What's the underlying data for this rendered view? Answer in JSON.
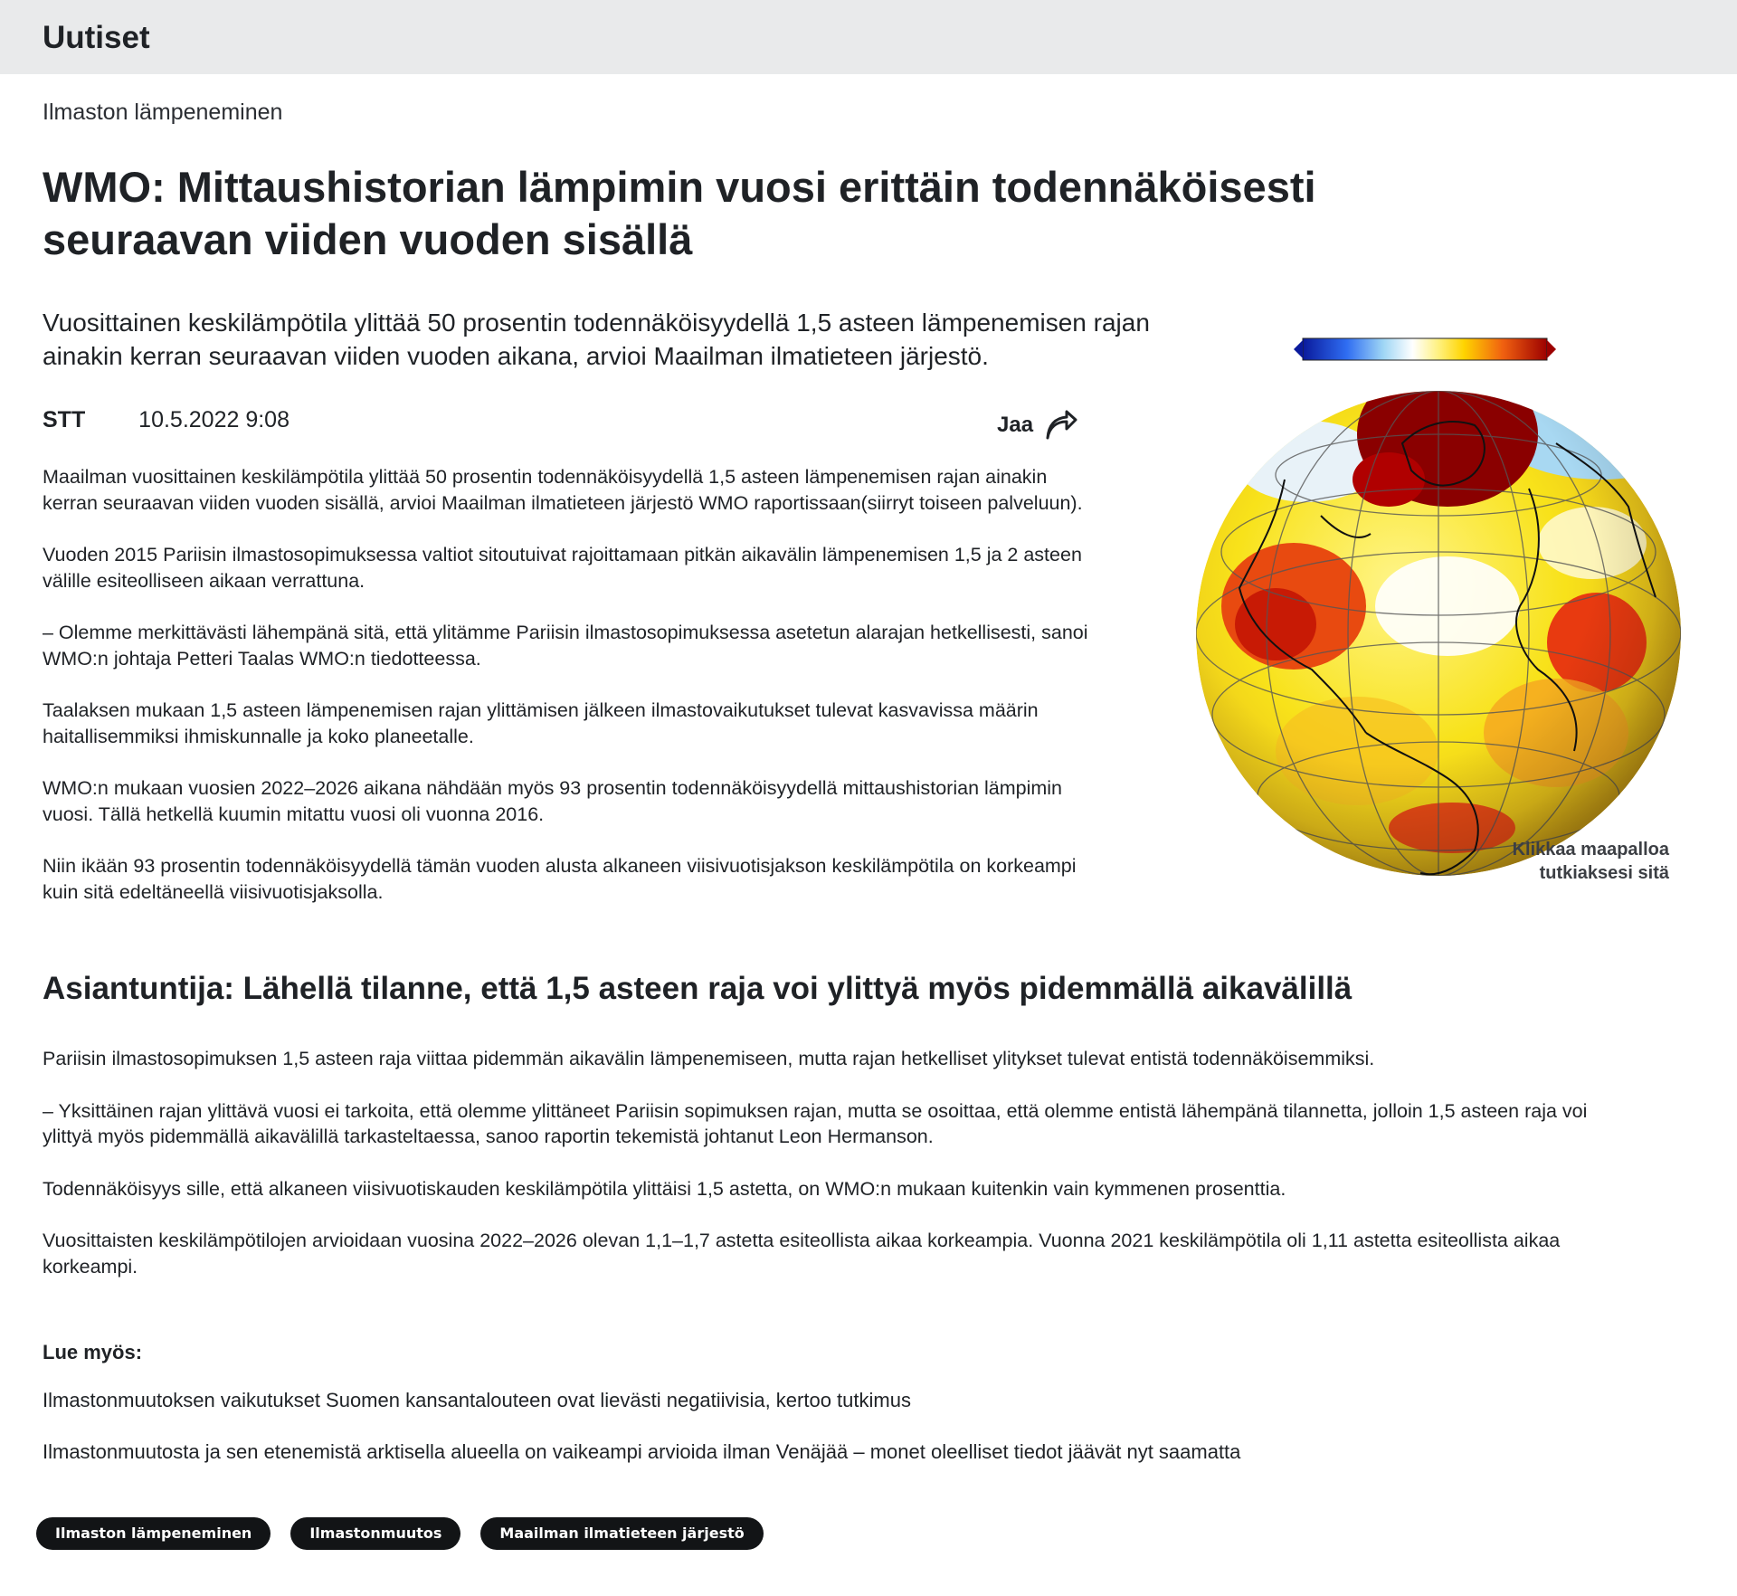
{
  "header": {
    "brand": "Uutiset"
  },
  "article": {
    "section": "Ilmaston lämpeneminen",
    "headline": "WMO: Mittaushistorian lämpimin vuosi erittäin todennäköisesti seuraavan viiden vuoden sisällä",
    "lead": "Vuosittainen keskilämpötila ylittää 50 prosentin todennäköisyydellä 1,5 asteen lämpenemisen rajan ainakin kerran seuraavan viiden vuoden aikana, arvioi Maailman ilmatieteen järjestö.",
    "author": "STT",
    "date": "10.5.2022 9:08",
    "share_label": "Jaa",
    "paragraphs": [
      "Maailman vuosittainen keskilämpötila ylittää 50 prosentin todennäköisyydellä 1,5 asteen lämpenemisen rajan ainakin kerran seuraavan viiden vuoden sisällä, arvioi Maailman ilmatieteen järjestö WMO raportissaan(siirryt toiseen palveluun).",
      "Vuoden 2015 Pariisin ilmastosopimuksessa valtiot sitoutuivat rajoittamaan pitkän aikavälin lämpenemisen 1,5 ja 2 asteen välille esiteolliseen aikaan verrattuna.",
      "– Olemme merkittävästi lähempänä sitä, että ylitämme Pariisin ilmastosopimuksessa asetetun alarajan hetkellisesti, sanoi WMO:n johtaja Petteri Taalas WMO:n tiedotteessa.",
      "Taalaksen mukaan 1,5 asteen lämpenemisen rajan ylittämisen jälkeen ilmastovaikutukset tulevat kasvavissa määrin haitallisemmiksi ihmiskunnalle ja koko planeetalle.",
      "WMO:n mukaan vuosien 2022–2026 aikana nähdään myös 93 prosentin todennäköisyydellä mittaushistorian lämpimin vuosi. Tällä hetkellä kuumin mitattu vuosi oli vuonna 2016.",
      "Niin ikään 93 prosentin todennäköisyydellä tämän vuoden alusta alkaneen viisivuotisjakson keskilämpötila on korkeampi kuin sitä edeltäneellä viisivuotisjaksolla."
    ],
    "globe_caption": "Klikkaa maapalloa tutkiaksesi sitä",
    "subheading": "Asiantuntija: Lähellä tilanne, että 1,5 asteen raja voi ylittyä myös pidemmällä aikavälillä",
    "paragraphs2": [
      "Pariisin ilmastosopimuksen 1,5 asteen raja viittaa pidemmän aikavälin lämpenemiseen, mutta rajan hetkelliset ylitykset tulevat entistä todennäköisemmiksi.",
      "– Yksittäinen rajan ylittävä vuosi ei tarkoita, että olemme ylittäneet Pariisin sopimuksen rajan, mutta se osoittaa, että olemme entistä lähempänä tilannetta, jolloin 1,5 asteen raja voi ylittyä myös pidemmällä aikavälillä tarkasteltaessa, sanoo raportin tekemistä johtanut Leon Hermanson.",
      "Todennäköisyys sille, että alkaneen viisivuotiskauden keskilämpötila ylittäisi 1,5 astetta, on WMO:n mukaan kuitenkin vain kymmenen prosenttia.",
      "Vuosittaisten keskilämpötilojen arvioidaan vuosina 2022–2026 olevan 1,1–1,7 astetta esiteollista aikaa korkeampia. Vuonna 2021 keskilämpötila oli 1,11 astetta esiteollista aikaa korkeampi."
    ],
    "read_more_title": "Lue myös:",
    "read_more": [
      "Ilmastonmuutoksen vaikutukset Suomen kansantalouteen ovat lievästi negatiivisia, kertoo tutkimus",
      "Ilmastonmuutosta ja sen etenemistä arktisella alueella on vaikeampi arvioida ilman Venäjää – monet oleelliset tiedot jäävät nyt saamatta"
    ],
    "tags": [
      "Ilmaston lämpeneminen",
      "Ilmastonmuutos",
      "Maailman ilmatieteen järjestö"
    ]
  },
  "icons": {
    "share": "share-arrow-icon"
  },
  "colors": {
    "topbar": "#e9eaeb",
    "text": "#1f2226",
    "tag_bg": "#121416"
  }
}
